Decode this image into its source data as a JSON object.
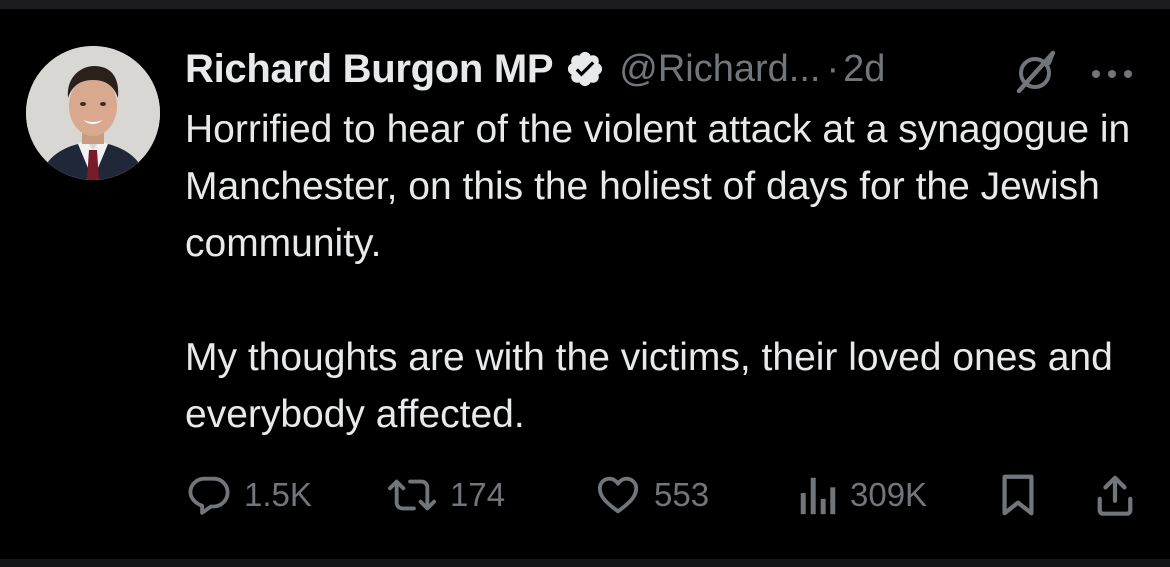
{
  "tweet": {
    "author": {
      "display_name": "Richard Burgon MP",
      "handle": "@Richard...",
      "verified": true
    },
    "separator": "·",
    "time": "2d",
    "text": {
      "paragraph1": "Horrified to hear of the violent attack at a synagogue in Manchester, on this the holiest of days for the Jewish community.",
      "paragraph2": "My thoughts are with the victims, their loved ones and everybody affected."
    },
    "stats": {
      "replies": "1.5K",
      "reposts": "174",
      "likes": "553",
      "views": "309K"
    }
  },
  "icons": {
    "verified": "verified-badge-icon",
    "grok": "grok-icon",
    "more": "more-horizontal-icon",
    "reply": "reply-icon",
    "repost": "repost-icon",
    "like": "heart-icon",
    "views": "views-icon",
    "bookmark": "bookmark-icon",
    "share": "share-icon"
  },
  "colors": {
    "background": "#000000",
    "primary_text": "#e7e9ea",
    "secondary_text": "#71767b"
  }
}
